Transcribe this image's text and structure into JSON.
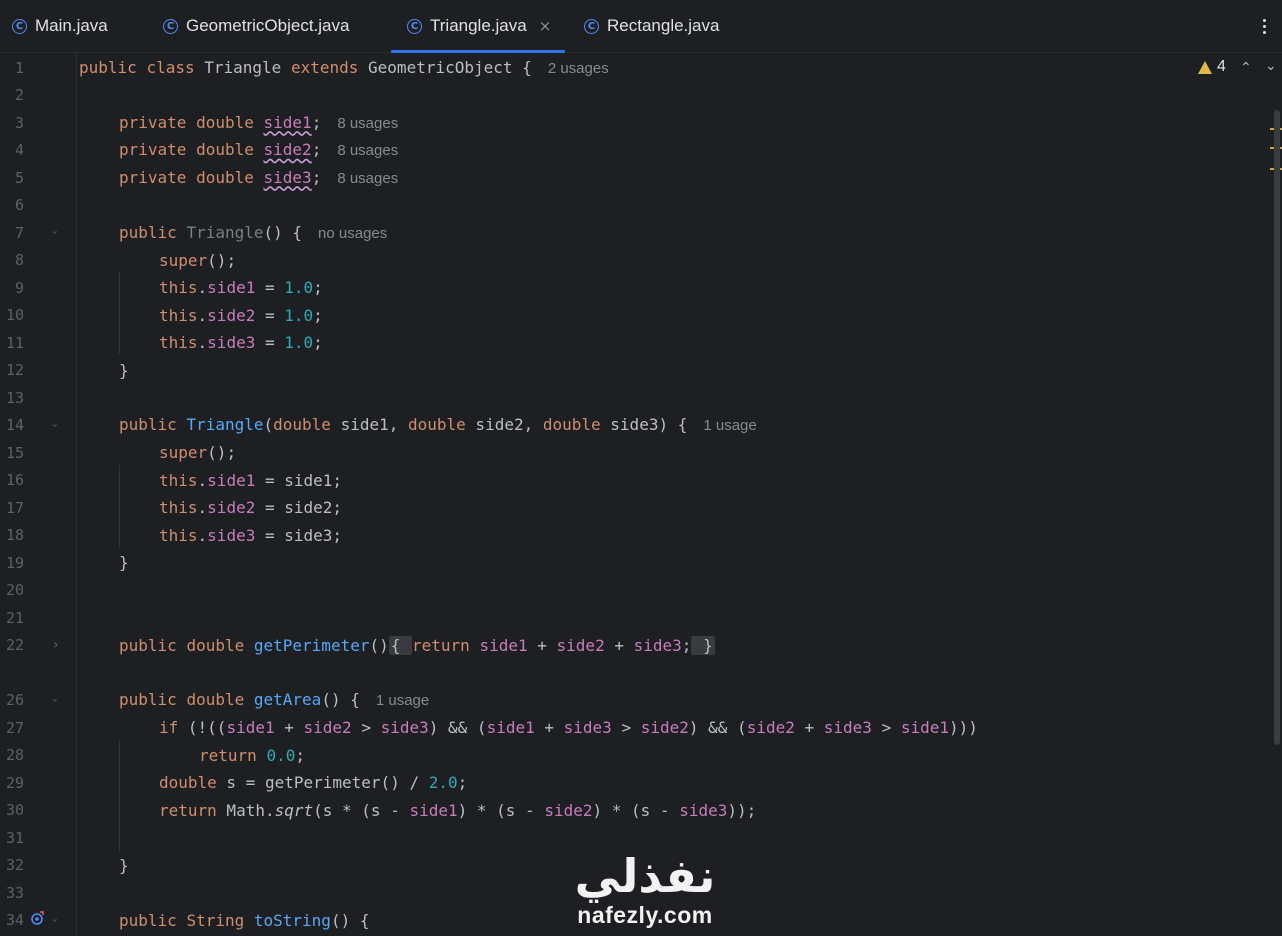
{
  "tabs": [
    {
      "label": "Main.java",
      "icon": "java-class-icon",
      "active": false
    },
    {
      "label": "GeometricObject.java",
      "icon": "java-class-icon",
      "active": false
    },
    {
      "label": "Triangle.java",
      "icon": "java-class-icon",
      "active": true
    },
    {
      "label": "Rectangle.java",
      "icon": "java-class-icon",
      "active": false
    }
  ],
  "tab_close_glyph": "×",
  "tab_icon_glyph": "C",
  "warnings": {
    "count": "4"
  },
  "hints": {
    "l1": "2 usages",
    "l3": "8 usages",
    "l4": "8 usages",
    "l5": "8 usages",
    "l7": "no usages",
    "l14": "1 usage",
    "l26": "1 usage"
  },
  "line_numbers": [
    "1",
    "2",
    "3",
    "4",
    "5",
    "6",
    "7",
    "8",
    "9",
    "10",
    "11",
    "12",
    "13",
    "14",
    "15",
    "16",
    "17",
    "18",
    "19",
    "20",
    "21",
    "22",
    "26",
    "27",
    "28",
    "29",
    "30",
    "31",
    "32",
    "33",
    "34"
  ],
  "code": {
    "l1": [
      "public",
      "class",
      "Triangle",
      "extends",
      "GeometricObject",
      "{"
    ],
    "l3": [
      "private",
      "double",
      "side1",
      ";"
    ],
    "l4": [
      "private",
      "double",
      "side2",
      ";"
    ],
    "l5": [
      "private",
      "double",
      "side3",
      ";"
    ],
    "l7": [
      "public",
      "Triangle",
      "() {"
    ],
    "l8": [
      "super",
      "();"
    ],
    "l9": [
      "this",
      ".",
      "side1",
      " = ",
      "1.0",
      ";"
    ],
    "l10": [
      "this",
      ".",
      "side2",
      " = ",
      "1.0",
      ";"
    ],
    "l11": [
      "this",
      ".",
      "side3",
      " = ",
      "1.0",
      ";"
    ],
    "l12": [
      "}"
    ],
    "l14": [
      "public",
      "Triangle",
      "(",
      "double",
      " side1, ",
      "double",
      " side2, ",
      "double",
      " side3) {"
    ],
    "l15": [
      "super",
      "();"
    ],
    "l16": [
      "this",
      ".",
      "side1",
      " = side1;"
    ],
    "l17": [
      "this",
      ".",
      "side2",
      " = side2;"
    ],
    "l18": [
      "this",
      ".",
      "side3",
      " = side3;"
    ],
    "l19": [
      "}"
    ],
    "l22": [
      "public",
      "double",
      "getPerimeter",
      "()",
      "{",
      "return",
      "side1",
      " + ",
      "side2",
      " + ",
      "side3",
      ";",
      "}"
    ],
    "l26": [
      "public",
      "double",
      "getArea",
      "() {"
    ],
    "l27": [
      "if",
      " (!((",
      "side1",
      " + ",
      "side2",
      " > ",
      "side3",
      ") && (",
      "side1",
      " + ",
      "side3",
      " > ",
      "side2",
      ") && (",
      "side2",
      " + ",
      "side3",
      " > ",
      "side1",
      ")))"
    ],
    "l28": [
      "return",
      "0.0",
      ";"
    ],
    "l29": [
      "double",
      " s = getPerimeter() / ",
      "2.0",
      ";"
    ],
    "l30": [
      "return",
      " Math.",
      "sqrt",
      "(s * (s - ",
      "side1",
      ") * (s - ",
      "side2",
      ") * (s - ",
      "side3",
      "));"
    ],
    "l32": [
      "}"
    ],
    "l34": [
      "public",
      "String",
      "toString",
      "() {"
    ]
  },
  "watermark": {
    "arabic": "نفذلي",
    "latin": "nafezly.com"
  },
  "colors": {
    "background": "#1e1f22",
    "keyword": "#cf8e6d",
    "field": "#c77dbb",
    "number": "#2aacb8",
    "method": "#56a8f5",
    "accent": "#3574f0",
    "warning": "#e0b84a"
  }
}
